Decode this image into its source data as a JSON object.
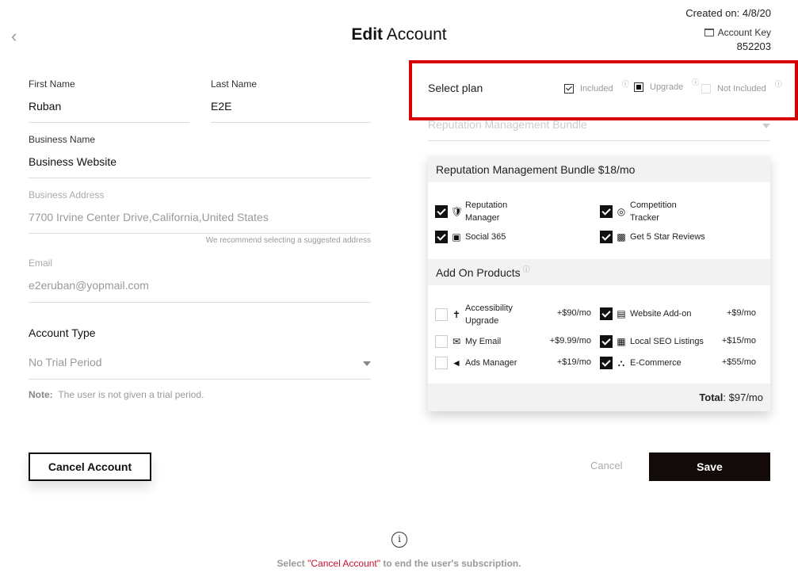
{
  "header": {
    "title_bold": "Edit",
    "title_rest": " Account",
    "created": "Created on: 4/8/20",
    "account_key_label": "Account Key",
    "account_key_value": "852203"
  },
  "form": {
    "first_name_label": "First Name",
    "first_name_value": "Ruban",
    "last_name_label": "Last Name",
    "last_name_value": "E2E",
    "business_name_label": "Business Name",
    "business_name_value": "Business Website",
    "business_address_label": "Business Address",
    "business_address_value": "7700 Irvine Center Drive,California,United States",
    "address_hint": "We recommend selecting a suggested address",
    "email_label": "Email",
    "email_value": "e2eruban@yopmail.com",
    "account_type_label": "Account Type",
    "account_type_value": "No Trial Period",
    "note_label": "Note:",
    "note_text": "The user is not given a trial period."
  },
  "plan": {
    "label": "Select plan",
    "legend": [
      {
        "label": "Included",
        "state": "checked"
      },
      {
        "label": "Upgrade",
        "state": "square"
      },
      {
        "label": "Not Included",
        "state": "empty"
      }
    ],
    "info_glyph": "ⓘ",
    "select_value": "Reputation Management Bundle"
  },
  "bundle": {
    "title": "Reputation Management Bundle $18/mo",
    "included": [
      {
        "label_line1": "Reputation",
        "label_line2": "Manager",
        "icon": "shield-icon",
        "checked": true
      },
      {
        "label_line1": "Competition",
        "label_line2": "Tracker",
        "icon": "radar-icon",
        "checked": true
      },
      {
        "label_line1": "Social 365",
        "label_line2": "",
        "icon": "calendar-icon",
        "checked": true
      },
      {
        "label_line1": "Get 5 Star Reviews",
        "label_line2": "",
        "icon": "reviews-icon",
        "checked": true
      }
    ],
    "addons_title": "Add On Products",
    "addons": [
      {
        "label_line1": "Accessibility",
        "label_line2": "Upgrade",
        "price": "+$90/mo",
        "icon": "accessibility-icon",
        "checked": false
      },
      {
        "label_line1": "Website Add-on",
        "label_line2": "",
        "price": "+$9/mo",
        "icon": "browser-window-icon",
        "checked": true
      },
      {
        "label_line1": "My Email",
        "label_line2": "",
        "price": "+$9.99/mo",
        "icon": "envelope-icon",
        "checked": false
      },
      {
        "label_line1": "Local SEO Listings",
        "label_line2": "",
        "price": "+$15/mo",
        "icon": "building-icon",
        "checked": true
      },
      {
        "label_line1": "Ads Manager",
        "label_line2": "",
        "price": "+$19/mo",
        "icon": "megaphone-icon",
        "checked": false
      },
      {
        "label_line1": "E-Commerce",
        "label_line2": "",
        "price": "+$55/mo",
        "icon": "cart-icon",
        "checked": true
      }
    ],
    "total_label": "Total",
    "total_value": ": $97/mo"
  },
  "actions": {
    "cancel_account": "Cancel Account",
    "cancel": "Cancel",
    "save": "Save"
  },
  "footer": {
    "info_glyph": "i",
    "text_before": "Select ",
    "link_text": "\"Cancel Account\"",
    "text_after": " to end the user's subscription."
  },
  "colors": {
    "highlight_border": "#d40000",
    "save_bg": "#130a0a",
    "link_red": "#c8102e"
  }
}
